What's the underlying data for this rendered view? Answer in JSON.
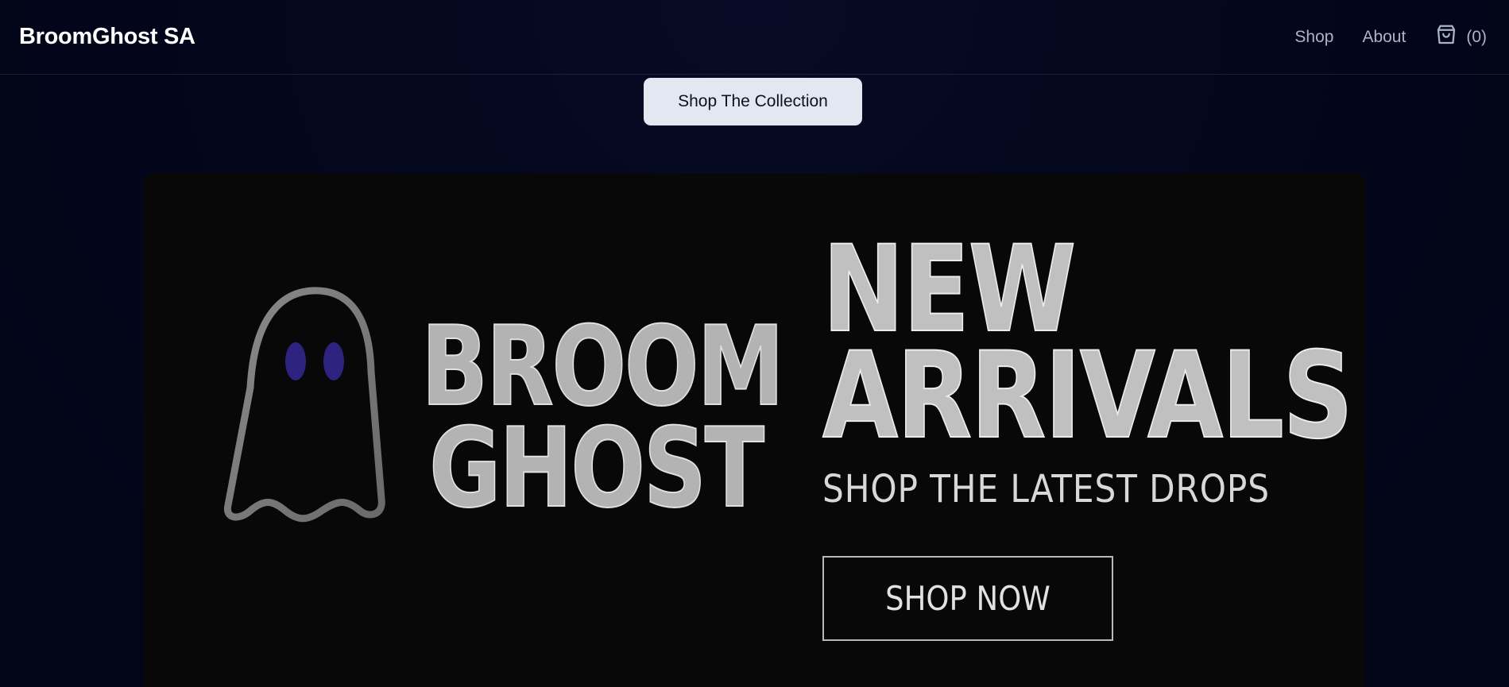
{
  "header": {
    "brand": "BroomGhost SA",
    "nav": {
      "shop": "Shop",
      "about": "About"
    },
    "cart": {
      "icon": "shopping-bag-icon",
      "count_label": "(0)"
    }
  },
  "hero": {
    "collection_button": "Shop The Collection"
  },
  "banner": {
    "logo": {
      "line1": "BROOM",
      "line2": "GHOST",
      "icon": "ghost-icon"
    },
    "headline": {
      "line1": "NEW",
      "line2": "ARRIVALS"
    },
    "subheadline": "SHOP THE LATEST DROPS",
    "cta": "SHOP NOW"
  },
  "colors": {
    "background": "#03061a",
    "banner": "#080808",
    "button_bg": "#e2e8f2",
    "ghost_eyes": "#2e2480"
  }
}
